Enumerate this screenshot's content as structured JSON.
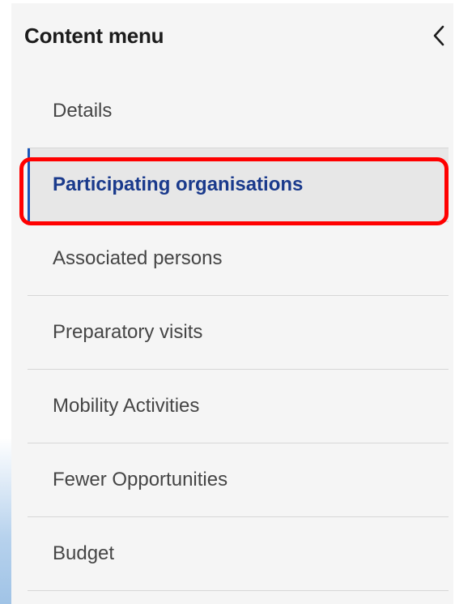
{
  "menu": {
    "title": "Content menu",
    "collapse_icon": "chevron-left-icon",
    "items": [
      {
        "label": "Details"
      },
      {
        "label": "Participating organisations",
        "active": true
      },
      {
        "label": "Associated persons"
      },
      {
        "label": "Preparatory visits"
      },
      {
        "label": "Mobility Activities"
      },
      {
        "label": "Fewer Opportunities"
      },
      {
        "label": "Budget"
      }
    ]
  },
  "colors": {
    "active_text": "#1a3a8c",
    "active_border": "#1a55b8",
    "highlight_box": "#ff0000",
    "panel_bg": "#f5f5f5"
  }
}
